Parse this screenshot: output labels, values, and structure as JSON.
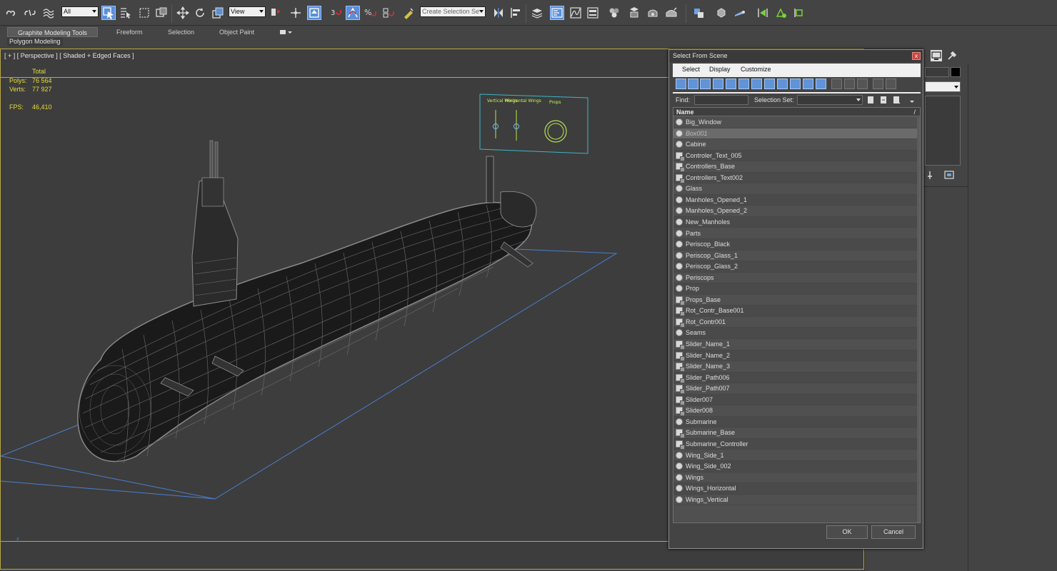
{
  "toolbar": {
    "filter_value": "All",
    "refcoord_value": "View",
    "selset_placeholder": "Create Selection Se"
  },
  "ribbon": {
    "tabs": [
      "Graphite Modeling Tools",
      "Freeform",
      "Selection",
      "Object Paint"
    ],
    "active_panel": "Polygon Modeling"
  },
  "viewport": {
    "label": "[ + ] [ Perspective ] [ Shaded + Edged Faces ]",
    "stats": {
      "total_label": "Total",
      "polys_label": "Polys:",
      "polys_value": "76 564",
      "verts_label": "Verts:",
      "verts_value": "77 927",
      "fps_label": "FPS:",
      "fps_value": "46,410"
    },
    "controller_labels": {
      "vertical": "Vertical Wings",
      "horizontal": "Horizontal Wings",
      "props": "Props"
    },
    "axis_label": "z"
  },
  "dialog": {
    "title": "Select From Scene",
    "close_glyph": "x",
    "menu": [
      "Select",
      "Display",
      "Customize"
    ],
    "find_label": "Find:",
    "selset_label": "Selection Set:",
    "column_name": "Name",
    "ok_label": "OK",
    "cancel_label": "Cancel",
    "items": [
      {
        "name": "Big_Window",
        "icon": "sphere"
      },
      {
        "name": "Box001",
        "icon": "sphere",
        "selected": true
      },
      {
        "name": "Cabine",
        "icon": "sphere"
      },
      {
        "name": "Controler_Text_005",
        "icon": "shape"
      },
      {
        "name": "Controllers_Base",
        "icon": "shape"
      },
      {
        "name": "Controllers_Text002",
        "icon": "shape"
      },
      {
        "name": "Glass",
        "icon": "sphere"
      },
      {
        "name": "Manholes_Opened_1",
        "icon": "sphere"
      },
      {
        "name": "Manholes_Opened_2",
        "icon": "sphere"
      },
      {
        "name": "New_Manholes",
        "icon": "sphere"
      },
      {
        "name": "Parts",
        "icon": "sphere"
      },
      {
        "name": "Periscop_Black",
        "icon": "sphere"
      },
      {
        "name": "Periscop_Glass_1",
        "icon": "sphere"
      },
      {
        "name": "Periscop_Glass_2",
        "icon": "sphere"
      },
      {
        "name": "Periscops",
        "icon": "sphere"
      },
      {
        "name": "Prop",
        "icon": "sphere"
      },
      {
        "name": "Props_Base",
        "icon": "shape"
      },
      {
        "name": "Rot_Contr_Base001",
        "icon": "shape"
      },
      {
        "name": "Rot_Contr001",
        "icon": "shape"
      },
      {
        "name": "Seams",
        "icon": "sphere"
      },
      {
        "name": "Slider_Name_1",
        "icon": "shape"
      },
      {
        "name": "Slider_Name_2",
        "icon": "shape"
      },
      {
        "name": "Slider_Name_3",
        "icon": "shape"
      },
      {
        "name": "Slider_Path006",
        "icon": "shape"
      },
      {
        "name": "Slider_Path007",
        "icon": "shape"
      },
      {
        "name": "Slider007",
        "icon": "shape"
      },
      {
        "name": "Slider008",
        "icon": "shape"
      },
      {
        "name": "Submarine",
        "icon": "sphere"
      },
      {
        "name": "Submarine_Base",
        "icon": "shape"
      },
      {
        "name": "Submarine_Controller",
        "icon": "shape"
      },
      {
        "name": "Wing_Side_1",
        "icon": "sphere"
      },
      {
        "name": "Wing_Side_002",
        "icon": "sphere"
      },
      {
        "name": "Wings",
        "icon": "sphere"
      },
      {
        "name": "Wings_Horizontal",
        "icon": "sphere"
      },
      {
        "name": "Wings_Vertical",
        "icon": "sphere"
      }
    ]
  },
  "colors": {
    "accent": "#5b8fd8",
    "stats": "#e7dc3a",
    "viewport_border": "#b8a544",
    "grid": "#4a7fd0",
    "controller": "#b7e34d",
    "close": "#c9463d"
  }
}
